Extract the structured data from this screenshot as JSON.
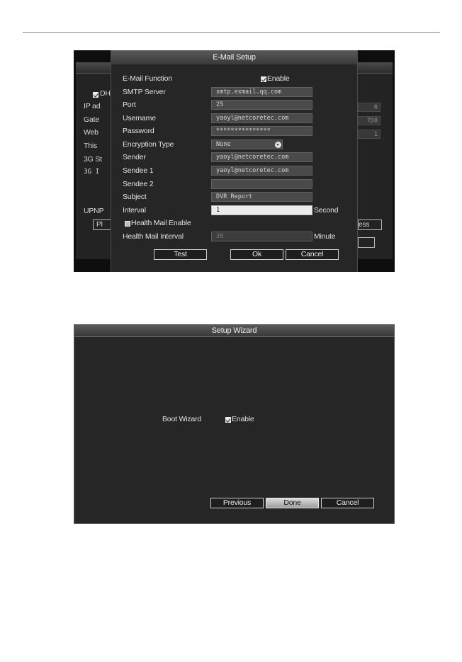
{
  "email_dialog": {
    "title": "E-Mail Setup",
    "email_function_label": "E-Mail Function",
    "enable_label": "Enable",
    "smtp_server_label": "SMTP Server",
    "smtp_server_value": "smtp.exmail.qq.com",
    "port_label": "Port",
    "port_value": "25",
    "username_label": "Username",
    "username_value": "yaoyl@netcoretec.com",
    "password_label": "Password",
    "password_value": "***************",
    "encryption_label": "Encryption Type",
    "encryption_value": "None",
    "sender_label": "Sender",
    "sender_value": "yaoyl@netcoretec.com",
    "sendee1_label": "Sendee 1",
    "sendee1_value": "yaoyl@netcoretec.com",
    "sendee2_label": "Sendee 2",
    "sendee2_value": "",
    "subject_label": "Subject",
    "subject_value": "DVR Report",
    "interval_label": "Interval",
    "interval_value": "1",
    "interval_unit": "Second",
    "health_mail_enable_label": "Health Mail Enable",
    "health_mail_interval_label": "Health Mail Interval",
    "health_mail_interval_value": "30",
    "health_mail_interval_unit": "Minute",
    "test_button": "Test",
    "ok_button": "Ok",
    "cancel_button": "Cancel"
  },
  "background_window": {
    "dhcp_label": "DH",
    "ip_label": "IP ad",
    "gateway_label": "Gate",
    "web_label": "Web",
    "this_label": "This",
    "status_3g_label": "3G St",
    "ip_3g_label": "3G I",
    "upnp_label": "UPNP",
    "left_button_fragment": "Pl",
    "right_button_fragment": "ess",
    "ip_value_fragment": "0",
    "gateway_value_fragment": "7D8",
    "web_value_fragment": "1"
  },
  "setup_wizard": {
    "title": "Setup Wizard",
    "boot_wizard_label": "Boot Wizard",
    "enable_label": "Enable",
    "previous_button": "Previous",
    "done_button": "Done",
    "cancel_button": "Cancel"
  }
}
